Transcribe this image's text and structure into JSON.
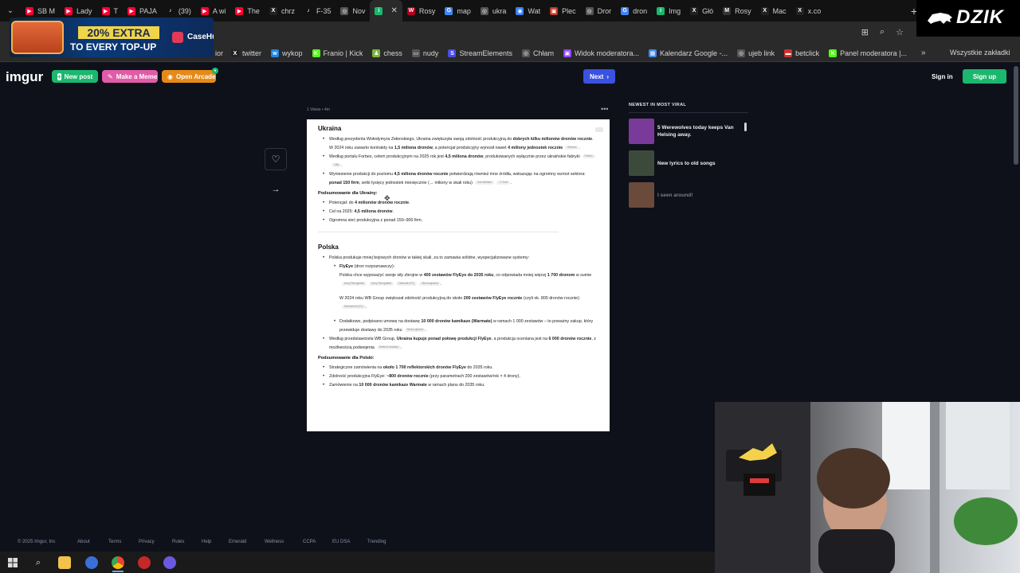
{
  "browser": {
    "tabs": [
      {
        "label": "SB M",
        "color": "#ff0033",
        "glyph": "▶"
      },
      {
        "label": "Lady",
        "color": "#ff0033",
        "glyph": "▶"
      },
      {
        "label": "T",
        "color": "#ff0033",
        "glyph": "▶"
      },
      {
        "label": "PAJA",
        "color": "#ff0033",
        "glyph": "▶"
      },
      {
        "label": "(39)",
        "color": "#111111",
        "glyph": "♪"
      },
      {
        "label": "A wi",
        "color": "#ff0033",
        "glyph": "▶"
      },
      {
        "label": "The",
        "color": "#ff0033",
        "glyph": "▶"
      },
      {
        "label": "chrz",
        "color": "#222222",
        "glyph": "X"
      },
      {
        "label": "F-35",
        "color": "#111111",
        "glyph": "♪"
      },
      {
        "label": "Nov",
        "color": "#555555",
        "glyph": "◎"
      },
      {
        "label": "",
        "color": "#1bb76e",
        "glyph": "i",
        "active": true
      },
      {
        "label": "Rosy",
        "color": "#b00020",
        "glyph": "W"
      },
      {
        "label": "map",
        "color": "#4285f4",
        "glyph": "G"
      },
      {
        "label": "ukra",
        "color": "#555555",
        "glyph": "◎"
      },
      {
        "label": "Wat",
        "color": "#3b82f6",
        "glyph": "◉"
      },
      {
        "label": "Plec",
        "color": "#c0392b",
        "glyph": "▣"
      },
      {
        "label": "Dror",
        "color": "#555555",
        "glyph": "◎"
      },
      {
        "label": "dron",
        "color": "#4285f4",
        "glyph": "G"
      },
      {
        "label": "Img",
        "color": "#1bb76e",
        "glyph": "i"
      },
      {
        "label": "Głó",
        "color": "#222222",
        "glyph": "X"
      },
      {
        "label": "Rosy",
        "color": "#333333",
        "glyph": "M"
      },
      {
        "label": "Mac",
        "color": "#222222",
        "glyph": "X"
      },
      {
        "label": "x.co",
        "color": "#222222",
        "glyph": "X"
      }
    ],
    "bookmarks": [
      {
        "label": "twitter",
        "color": "#222222",
        "glyph": "X"
      },
      {
        "label": "wykop",
        "color": "#1e88e5",
        "glyph": "w"
      },
      {
        "label": "Franio | Kick",
        "color": "#53fc18",
        "glyph": "K"
      },
      {
        "label": "chess",
        "color": "#7cb342",
        "glyph": "♟"
      },
      {
        "label": "nudy",
        "color": "#555555",
        "glyph": "▭"
      },
      {
        "label": "StreamElements",
        "color": "#4a4ae8",
        "glyph": "S"
      },
      {
        "label": "Chłam",
        "color": "#555555",
        "glyph": "◎"
      },
      {
        "label": "Widok moderatora...",
        "color": "#9146ff",
        "glyph": "▣"
      },
      {
        "label": "Kalendarz Google -...",
        "color": "#4285f4",
        "glyph": "▦"
      },
      {
        "label": "ujeb link",
        "color": "#555555",
        "glyph": "◎"
      },
      {
        "label": "betclick",
        "color": "#d32f2f",
        "glyph": "▬"
      },
      {
        "label": "Panel moderatora |...",
        "color": "#53fc18",
        "glyph": "K"
      }
    ],
    "bookmarks_all": "Wszystkie zakładki",
    "bookmarks_partial": "ior"
  },
  "overlay": {
    "ad_line1": "20% EXTRA",
    "ad_line2": "TO EVERY TOP-UP",
    "ad_brand": "CaseHug",
    "channel": "DZIK"
  },
  "header": {
    "logo": "imgur",
    "new_post": "New post",
    "make_meme": "Make a Meme",
    "open_arcade": "Open Arcade",
    "next": "Next",
    "sign_in": "Sign in",
    "sign_up": "Sign up"
  },
  "post": {
    "meta": "1 Views  •  4m",
    "ukraina": {
      "heading": "Ukraina",
      "items": [
        {
          "html": "Według prezydenta Wołodymyra Zełenskiego, Ukraina zwiększyła swoją zdolność produkcyjną do <b>dobrych kilku milionów dronów rocznie</b>. W 2024 roku zawarto kontrakty na <b>1,5 miliona dronów</b>, a potencjał produkcyjny wynosił nawet <b>4 miliony jednostek rocznie</b><span class='src'>Reuters</span>."
        },
        {
          "html": "Według portalu Forbes, celem produkcyjnym na 2025 rok jest <b>4,5 miliona dronów</b>, produkowanych wyłącznie przez ukraińskie fabryki<span class='src'>Forbes</span><span class='src'>LBN</span>."
        },
        {
          "html": "Wyniesienie produkcji do poziomu <b>4,5 miliona dronów rocznie</b> potwierdzają również inne źródła, wskazując na ogromny wzrost sektora: <b>ponad 150 firm</b>, setki tysięcy jednostek miesięcznie (→ miliony w skali roku)<span class='src'>Cas Webster</span><span class='src'>+1 Tech</span>."
        }
      ],
      "summary_title": "Podsumowanie dla Ukrainy:",
      "summary": [
        {
          "html": "Potencjał: do <b>4 milionów dronów rocznie</b>."
        },
        {
          "html": "Cel na 2025: <b>4,5 miliona dronów</b>."
        },
        {
          "html": "Ogromna sieć produkcyjna z ponad 150–900 firm."
        }
      ]
    },
    "polska": {
      "heading": "Polska",
      "intro": {
        "html": "Polska produkuje mniej bojowych dronów w takiej skali, za to zamawia solidne, wyspecjalizowane systemy:"
      },
      "flyeye_label": {
        "html": "<b>FlyEye</b> (dron rozpoznawczy):"
      },
      "flyeye_p1": "Polska chce wyposażyć swoje siły zbrojne w <b>400 zestawów FlyEye do 2035 roku</b>, co odpowiada mniej więcej <b>1 700 dronom</b> w sumie<span class='src'>Army Recognition</span><span class='src'>Army Recognition</span><span class='src'>Defender (PL)</span><span class='src'>Strona główna</span>.",
      "flyeye_p2": "W 2024 roku WB Group zwiększał zdolność produkcyjną do około <b>200 zestawów FlyEye rocznie</b> (czyli ok. 800 dronów rocznie)<span class='src'>Defender24 (PL)</span>.",
      "warmate": {
        "html": "Dodatkowo, podpisano umowę na dostawę <b>10 000 dronów kamikaze (Warmate)</b> w ramach 1 000 zestawów – to poważny zakup, który przewiduje dostawy do 2035 roku<span class='src'>Strona główna</span>."
      },
      "wb": {
        "html": "Według przedstawiciela WB Group, <b>Ukraina kupuje ponad połowę produkcji FlyEye</b>, a produkcja oceniana jest na <b>6 000 dronów rocznie</b>, z możliwością podwojenia<span class='src'>Defence Industry</span>."
      },
      "summary_title": "Podsumowanie dla Polski:",
      "summary": [
        {
          "html": "Strategiczne zamówienia na <b>około 1 700 reflektorskich dronów FlyEye</b> do 2035 roku."
        },
        {
          "html": "Zdolność produkcyjna FlyEye: <b>~800 dronów rocznie</b> (przy parametrach 200 zestawów/rok × 4 drony)."
        },
        {
          "html": "Zamówienie na <b>10 000 dronów kamikaze Warmate</b> w ramach planu do 2035 roku."
        }
      ]
    }
  },
  "viral": {
    "title": "NEWEST IN MOST VIRAL",
    "items": [
      {
        "title": "5 Werewolves today keeps Van Helsing away.",
        "thumb": "#7a3a9a",
        "dim": false
      },
      {
        "title": "New lyrics to old songs",
        "thumb": "#3c4a3c",
        "dim": false
      },
      {
        "title": "I seen around!",
        "thumb": "#6a4a3a",
        "dim": true
      }
    ]
  },
  "footer": {
    "items": [
      "© 2025 Imgur, Inc",
      "About",
      "Terms",
      "Privacy",
      "Rules",
      "Help",
      "Emerald",
      "Wellness",
      "CCPA",
      "EU DSA",
      "Trending"
    ]
  },
  "taskbar": {
    "icons": [
      "windows-start-icon",
      "search-icon",
      "file-explorer-icon",
      "app-icon",
      "chrome-icon",
      "app-icon",
      "app-icon"
    ]
  }
}
